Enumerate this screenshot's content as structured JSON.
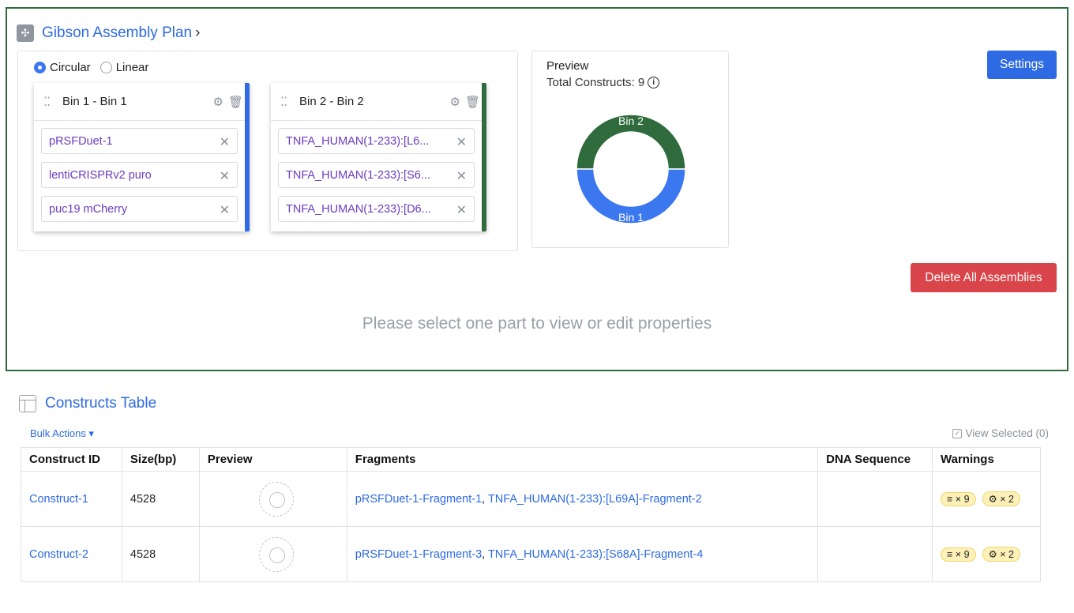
{
  "plan": {
    "title": "Gibson Assembly Plan",
    "chevron": "›",
    "topology": {
      "options": [
        "Circular",
        "Linear"
      ],
      "selected": "Circular"
    },
    "bins": [
      {
        "name": "Bin 1 - Bin 1",
        "color": "#2f6be6",
        "parts": [
          "pRSFDuet-1",
          "lentiCRISPRv2 puro",
          "puc19 mCherry"
        ]
      },
      {
        "name": "Bin 2 - Bin 2",
        "color": "#2f6b3c",
        "parts": [
          "TNFA_HUMAN(1-233):[L6...",
          "TNFA_HUMAN(1-233):[S6...",
          "TNFA_HUMAN(1-233):[D6..."
        ]
      }
    ],
    "preview": {
      "title": "Preview",
      "total_label": "Total Constructs: 9",
      "donut": [
        {
          "label": "Bin 2",
          "share": 0.5,
          "color": "#2f6b3c"
        },
        {
          "label": "Bin 1",
          "share": 0.5,
          "color": "#3b78f0"
        }
      ]
    },
    "settings_label": "Settings",
    "delete_label": "Delete All Assemblies",
    "hint": "Please select one part to view or edit properties"
  },
  "table": {
    "title": "Constructs Table",
    "bulk_label": "Bulk Actions ▾",
    "view_selected_label": "View Selected (0)",
    "columns": [
      "Construct ID",
      "Size(bp)",
      "Preview",
      "Fragments",
      "DNA Sequence",
      "Warnings"
    ],
    "rows": [
      {
        "id": "Construct-1",
        "size": "4528",
        "frag1": "pRSFDuet-1-Fragment-1",
        "frag2": "TNFA_HUMAN(1-233):[L69A]-Fragment-2",
        "warn1": "≡ × 9",
        "warn2": "⚙ × 2"
      },
      {
        "id": "Construct-2",
        "size": "4528",
        "frag1": "pRSFDuet-1-Fragment-3",
        "frag2": "TNFA_HUMAN(1-233):[S68A]-Fragment-4",
        "warn1": "≡ × 9",
        "warn2": "⚙ × 2"
      }
    ]
  }
}
